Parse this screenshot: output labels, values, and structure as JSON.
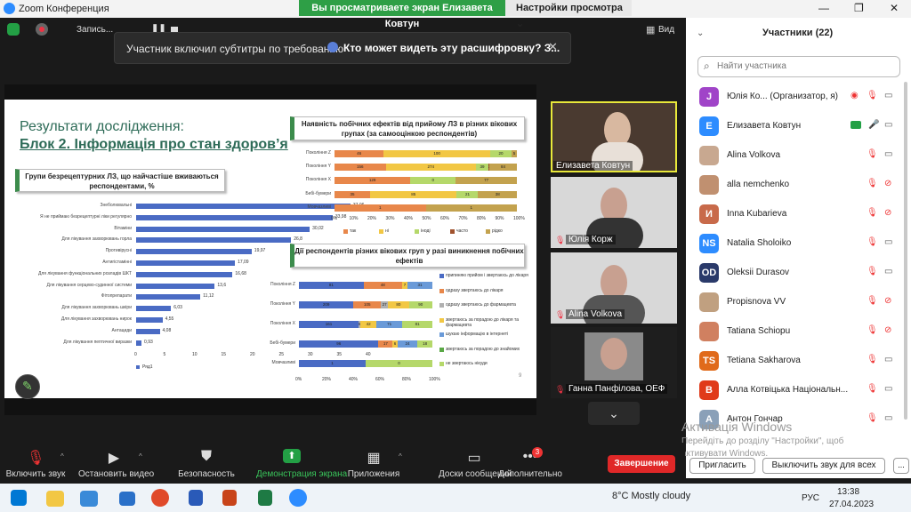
{
  "app": {
    "title": "Zoom Конференция"
  },
  "banner": {
    "sharing": "Вы просматриваете экран Елизавета Ковтун",
    "view_options": "Настройки просмотра",
    "view_label": "Вид"
  },
  "recording": {
    "label": "Запись..."
  },
  "caption": {
    "text": "Участник включил субтитры по требованию",
    "link": "Кто может видеть эту расшифровку? З..."
  },
  "slide": {
    "title1": "Результати дослідження:",
    "title2": "Блок 2. Інформація про стан здоров’я",
    "box1": "Групи безрецептурних ЛЗ, що найчастіше вживаються респондентами, %",
    "box2": "Наявність побічних ефектів від прийому ЛЗ в різних вікових групах (за самооцінкою респондентів)",
    "box3": "Дії респондентів різних вікових груп у разі виникнення побічних ефектів",
    "page_num": "9"
  },
  "chart_data": [
    {
      "type": "bar",
      "orientation": "horizontal",
      "categories": [
        "Знеболювальні",
        "Я не приймаю безрецептурні ліки регулярно",
        "Вітаміни",
        "Для лікування захворювань горла",
        "Противірусні",
        "Антигістамінні",
        "Для лікування функціональних розладів ШКТ",
        "Для лікування серцево-судинної системи",
        "Фітопрепарати",
        "Для лікування захворювань шкіри",
        "Для лікування захворювань нирок",
        "Антациди",
        "Для лікування пептичної виразки"
      ],
      "values": [
        37.06,
        33.98,
        30.02,
        26.8,
        19.97,
        17.09,
        16.68,
        13.6,
        11.12,
        6.03,
        4.55,
        4.08,
        0.93
      ],
      "labels": [
        "37,06",
        "33,98",
        "30,02",
        "26,8",
        "19,97",
        "17,09",
        "16,68",
        "13,6",
        "11,12",
        "6,03",
        "4,55",
        "4,08",
        "0,93"
      ],
      "xticks": [
        "0",
        "5",
        "10",
        "15",
        "20",
        "25",
        "30",
        "35",
        "40"
      ],
      "xlim": [
        0,
        40
      ],
      "legend": [
        "Ряд1"
      ],
      "color": "#4a6bc4"
    },
    {
      "type": "bar",
      "orientation": "horizontal",
      "stacked": "percent",
      "categories": [
        "Покоління Z",
        "Покоління Y",
        "Покоління X",
        "Бебі-бумери",
        "Мовчазливі"
      ],
      "series": [
        {
          "name": "так",
          "color": "#e8874a",
          "values": [
            46,
            156,
            129,
            35,
            1
          ]
        },
        {
          "name": "ні",
          "color": "#f2c744",
          "values": [
            100,
            274,
            0,
            85,
            0
          ]
        },
        {
          "name": "іноді",
          "color": "#b5d86a",
          "values": [
            20,
            39,
            77,
            21,
            0
          ]
        },
        {
          "name": "часто",
          "color": "#a0522d",
          "values": [
            0,
            2,
            0,
            0,
            0
          ]
        },
        {
          "name": "рідко",
          "color": "#c3a24e",
          "values": [
            5,
            84,
            104,
            38,
            1
          ]
        }
      ],
      "labels": [
        [
          "46",
          "100",
          "20",
          "5"
        ],
        [
          "156",
          "274",
          "39",
          "2",
          "84"
        ],
        [
          "129",
          "0",
          "77",
          "104"
        ],
        [
          "35",
          "85",
          "21",
          "38"
        ],
        [
          "1",
          "1"
        ]
      ],
      "xticks": [
        "0%",
        "10%",
        "20%",
        "30%",
        "40%",
        "50%",
        "60%",
        "70%",
        "80%",
        "90%",
        "100%"
      ]
    },
    {
      "type": "bar",
      "orientation": "horizontal",
      "stacked": "percent",
      "categories": [
        "Покоління Z",
        "Покоління Y",
        "Покоління X",
        "Бебі-бумери",
        "Мовчазливі"
      ],
      "series": [
        {
          "name": "припиняю прийом і звертаюсь до лікаря",
          "color": "#4a6bc4",
          "values": [
            81,
            209,
            161,
            96,
            1
          ]
        },
        {
          "name": "одразу звертаюсь до лікаря",
          "color": "#e8874a",
          "values": [
            48,
            105,
            0,
            17,
            0
          ]
        },
        {
          "name": "одразу звертаюсь до фармацевта",
          "color": "#b0b0b0",
          "values": [
            0,
            27,
            6,
            0,
            0
          ]
        },
        {
          "name": "звертаюсь за порадою до лікаря та фармацевта",
          "color": "#f2c744",
          "values": [
            7,
            80,
            42,
            6,
            0
          ]
        },
        {
          "name": "шукаю інформацію в інтернеті",
          "color": "#6a9ad8",
          "values": [
            31,
            0,
            71,
            24,
            0
          ]
        },
        {
          "name": "звертаюсь за порадою до знайомих",
          "color": "#5aa846",
          "values": [
            0,
            0,
            0,
            0,
            0
          ]
        },
        {
          "name": "не звертаюсь нікуди",
          "color": "#b5d86a",
          "values": [
            0,
            90,
            81,
            18,
            1
          ]
        }
      ],
      "labels": [
        [
          "81",
          "48",
          "7",
          "31"
        ],
        [
          "209",
          "105",
          "27",
          "80",
          "90"
        ],
        [
          "161",
          "6",
          "42",
          "71",
          "81"
        ],
        [
          "96",
          "17",
          "6",
          "24",
          "18"
        ],
        [
          "1",
          "0",
          "1"
        ]
      ],
      "xticks": [
        "0%",
        "20%",
        "40%",
        "60%",
        "80%",
        "100%"
      ]
    }
  ],
  "videos": [
    {
      "name": "Елизавета Ковтун"
    },
    {
      "name": "Юлія Корж"
    },
    {
      "name": "Alina Volkova"
    },
    {
      "name": "Ганна Панфілова, ОЕФ"
    }
  ],
  "panel": {
    "title": "Участники (22)",
    "search_placeholder": "Найти участника",
    "participants": [
      {
        "initial": "J",
        "name": "Юлія Ко...  (Организатор, я)",
        "color": "#a044c8"
      },
      {
        "initial": "E",
        "name": "Елизавета Ковтун",
        "color": "#2d8cff"
      },
      {
        "initial": "",
        "name": "Alina Volkova",
        "color": "#c8a890"
      },
      {
        "initial": "",
        "name": "alla nemchenko",
        "color": "#c09070"
      },
      {
        "initial": "И",
        "name": "Inna Kubarieva",
        "color": "#c86a4a"
      },
      {
        "initial": "NS",
        "name": "Natalia Sholoiko",
        "color": "#2d8cff"
      },
      {
        "initial": "OD",
        "name": "Oleksii Durasov",
        "color": "#2a3a6a"
      },
      {
        "initial": "",
        "name": "Propisnova VV",
        "color": "#c0a080"
      },
      {
        "initial": "",
        "name": "Tatiana Schiopu",
        "color": "#d08060"
      },
      {
        "initial": "TS",
        "name": "Tetiana Sakharova",
        "color": "#e06a1a"
      },
      {
        "initial": "B",
        "name": "Алла Котвіцька Національн...",
        "color": "#e03a1a"
      },
      {
        "initial": "A",
        "name": "Антон Гончар",
        "color": "#8aa0b8"
      }
    ],
    "invite": "Пригласить",
    "mute_all": "Выключить звук для всех",
    "more": "..."
  },
  "watermark": {
    "line1": "Активація Windows",
    "line2": "Перейдіть до розділу \"Настройки\", щоб",
    "line3": "активувати Windows."
  },
  "toolbar": {
    "items": [
      "Включить звук",
      "Остановить видео",
      "Безопасность",
      "Демонстрация экрана",
      "Приложения",
      "Доски сообщений",
      "Дополнительно"
    ],
    "end": "Завершение",
    "badge": "3"
  },
  "taskbar": {
    "weather": "8°C  Mostly cloudy",
    "lang": "РУС",
    "time": "13:38",
    "date": "27.04.2023"
  }
}
